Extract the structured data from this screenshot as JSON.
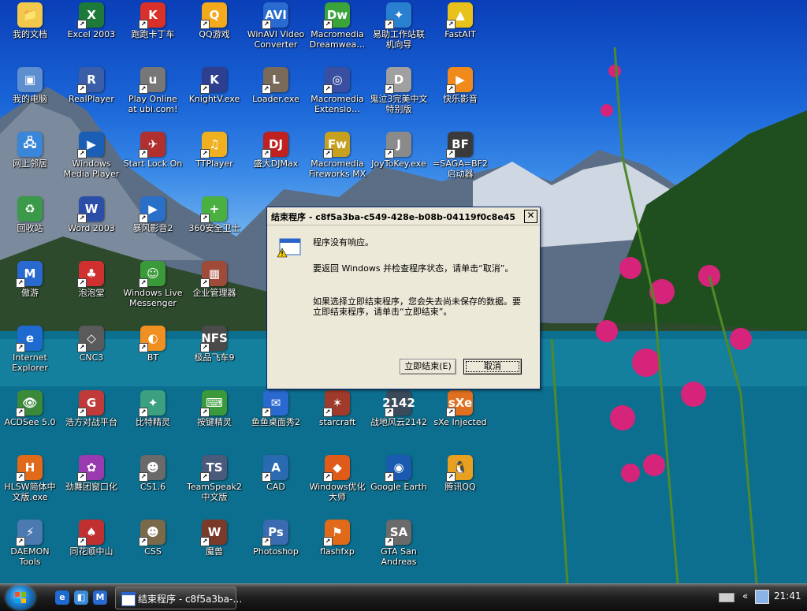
{
  "desktop": {
    "icons": [
      {
        "label": "我的文档",
        "glyph": "📁",
        "color": "#f2c94c"
      },
      {
        "label": "Excel 2003",
        "glyph": "X",
        "color": "#1d7a3a"
      },
      {
        "label": "跑跑卡丁车",
        "glyph": "K",
        "color": "#d9302a"
      },
      {
        "label": "QQ游戏",
        "glyph": "Q",
        "color": "#f2a91c"
      },
      {
        "label": "WinAVI Video Converter",
        "glyph": "AVI",
        "color": "#2a6bd1"
      },
      {
        "label": "Macromedia Dreamwea…",
        "glyph": "Dw",
        "color": "#3aa33a"
      },
      {
        "label": "易助工作站联机向导",
        "glyph": "✦",
        "color": "#2a80d0"
      },
      {
        "label": "FastAIT",
        "glyph": "▲",
        "color": "#e8c21a"
      },
      {
        "label": "我的电脑",
        "glyph": "▣",
        "color": "#5d8fd0"
      },
      {
        "label": "RealPlayer",
        "glyph": "R",
        "color": "#3a5fa8"
      },
      {
        "label": "Play Online at ubi.com!",
        "glyph": "u",
        "color": "#777777"
      },
      {
        "label": "KnightV.exe",
        "glyph": "K",
        "color": "#2f3f8f"
      },
      {
        "label": "Loader.exe",
        "glyph": "L",
        "color": "#7a6a5a"
      },
      {
        "label": "Macromedia Extensio…",
        "glyph": "◎",
        "color": "#3a4fa0"
      },
      {
        "label": "鬼泣3完美中文特别版",
        "glyph": "D",
        "color": "#a0a0a0"
      },
      {
        "label": "快乐影音",
        "glyph": "▶",
        "color": "#f08a1a"
      },
      {
        "label": "网上邻居",
        "glyph": "🖧",
        "color": "#3a86d8"
      },
      {
        "label": "Windows Media Player",
        "glyph": "▶",
        "color": "#1a5fb5"
      },
      {
        "label": "Start Lock On",
        "glyph": "✈",
        "color": "#b03030"
      },
      {
        "label": "TTPlayer",
        "glyph": "♫",
        "color": "#f0b020"
      },
      {
        "label": "盛大DJMax",
        "glyph": "DJ",
        "color": "#c02020"
      },
      {
        "label": "Macromedia Fireworks MX",
        "glyph": "Fw",
        "color": "#c8a020"
      },
      {
        "label": "JoyToKey.exe",
        "glyph": "J",
        "color": "#8a8a8a"
      },
      {
        "label": "=SAGA=BF2启动器",
        "glyph": "BF",
        "color": "#3a3a3a"
      },
      {
        "label": "回收站",
        "glyph": "♻",
        "color": "#3a9a4a"
      },
      {
        "label": "Word 2003",
        "glyph": "W",
        "color": "#2b4fa8"
      },
      {
        "label": "暴风影音2",
        "glyph": "▶",
        "color": "#2a70c8"
      },
      {
        "label": "360安全卫士",
        "glyph": "+",
        "color": "#4ab040"
      },
      {
        "label": "傲游",
        "glyph": "M",
        "color": "#2a6ad0"
      },
      {
        "label": "泡泡堂",
        "glyph": "♣",
        "color": "#d03030"
      },
      {
        "label": "Windows Live Messenger",
        "glyph": "☺",
        "color": "#3a9a3a"
      },
      {
        "label": "企业管理器",
        "glyph": "▦",
        "color": "#a04a3a"
      },
      {
        "label": "Internet Explorer",
        "glyph": "e",
        "color": "#1e6ad0"
      },
      {
        "label": "CNC3",
        "glyph": "◇",
        "color": "#5a5a5a"
      },
      {
        "label": "BT",
        "glyph": "◐",
        "color": "#f09020"
      },
      {
        "label": "极品飞车9",
        "glyph": "NFS",
        "color": "#4a4a4a"
      },
      {
        "label": "ACDSee 5.0",
        "glyph": "👁",
        "color": "#3a8a3a"
      },
      {
        "label": "浩方对战平台",
        "glyph": "G",
        "color": "#c03a3a"
      },
      {
        "label": "比特精灵",
        "glyph": "✦",
        "color": "#3aa080"
      },
      {
        "label": "按键精灵",
        "glyph": "⌨",
        "color": "#3a9a3a"
      },
      {
        "label": "鱼鱼桌面秀2",
        "glyph": "✉",
        "color": "#2a6ad0"
      },
      {
        "label": "starcraft",
        "glyph": "✶",
        "color": "#a03a2a"
      },
      {
        "label": "战地风云2142",
        "glyph": "2142",
        "color": "#3a4a5a"
      },
      {
        "label": "sXe Injected",
        "glyph": "sXe",
        "color": "#e07020"
      },
      {
        "label": "HLSW简体中文版.exe",
        "glyph": "H",
        "color": "#e06a1a"
      },
      {
        "label": "劲舞团窗口化",
        "glyph": "✿",
        "color": "#9a3ab0"
      },
      {
        "label": "CS1.6",
        "glyph": "☻",
        "color": "#6a6a6a"
      },
      {
        "label": "TeamSpeak2中文版",
        "glyph": "TS",
        "color": "#4a5a7a"
      },
      {
        "label": "CAD",
        "glyph": "A",
        "color": "#2a6ab0"
      },
      {
        "label": "Windows优化大师",
        "glyph": "◆",
        "color": "#e05a1a"
      },
      {
        "label": "Google Earth",
        "glyph": "◉",
        "color": "#1a5ab0"
      },
      {
        "label": "腾讯QQ",
        "glyph": "🐧",
        "color": "#e8a020"
      },
      {
        "label": "DAEMON Tools",
        "glyph": "⚡",
        "color": "#4a7ab0"
      },
      {
        "label": "同花顺中山",
        "glyph": "♠",
        "color": "#c03030"
      },
      {
        "label": "CSS",
        "glyph": "☻",
        "color": "#7a6a4a"
      },
      {
        "label": "魔兽",
        "glyph": "W",
        "color": "#7a3a2a"
      },
      {
        "label": "Photoshop",
        "glyph": "Ps",
        "color": "#3a6ab0"
      },
      {
        "label": "flashfxp",
        "glyph": "⚑",
        "color": "#e06a1a"
      },
      {
        "label": "GTA San Andreas",
        "glyph": "SA",
        "color": "#6a6a6a"
      }
    ]
  },
  "dialog": {
    "title": "结束程序 - c8f5a3ba-c549-428e-b08b-04119f0c8e45",
    "close": "✕",
    "line1": "程序没有响应。",
    "line2": "要返回 Windows 并检查程序状态，请单击“取消”。",
    "line3": "如果选择立即结束程序，您会失去尚未保存的数据。要立即结束程序，请单击“立即结束”。",
    "end_now": "立即结束(E)",
    "cancel": "取消"
  },
  "taskbar": {
    "task_label": "结束程序 - c8f5a3ba-…",
    "clock": "21:41",
    "tray_arrow": "«"
  }
}
